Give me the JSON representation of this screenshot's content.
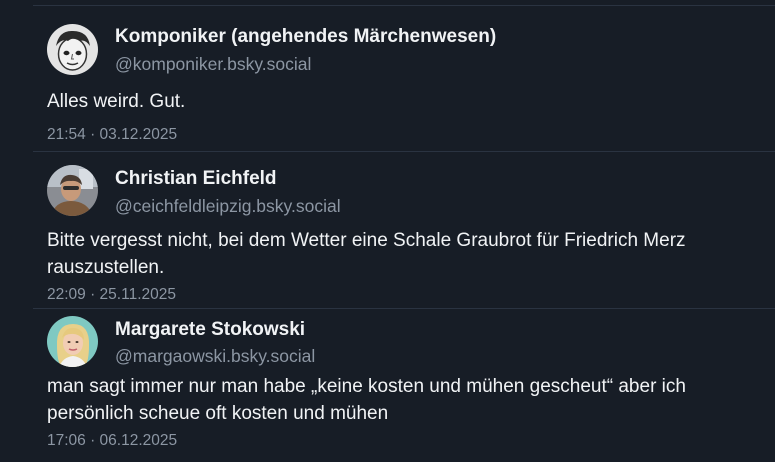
{
  "posts": [
    {
      "author": "Komponiker (angehendes Märchenwesen)",
      "handle": "@komponiker.bsky.social",
      "text": "Alles weird. Gut.",
      "time": "21:54 · 03.12.2025",
      "avatar": "avatar-cartoon-face"
    },
    {
      "author": "Christian Eichfeld",
      "handle": "@ceichfeldleipzig.bsky.social",
      "text": "Bitte vergesst nicht, bei dem Wetter eine Schale Graubrot für Friedrich Merz rauszustellen.",
      "time": "22:09 · 25.11.2025",
      "avatar": "avatar-photo"
    },
    {
      "author": "Margarete Stokowski",
      "handle": "@margaowski.bsky.social",
      "text": "man sagt immer nur man habe „keine kosten und mühen gescheut“ aber ich persönlich scheue oft kosten und mühen",
      "time": "17:06 · 06.12.2025",
      "avatar": "avatar-photo"
    }
  ],
  "colors": {
    "background": "#171d26",
    "divider": "#2a3341",
    "primary_text": "#f1f3f5",
    "secondary_text": "#8c96a3"
  }
}
